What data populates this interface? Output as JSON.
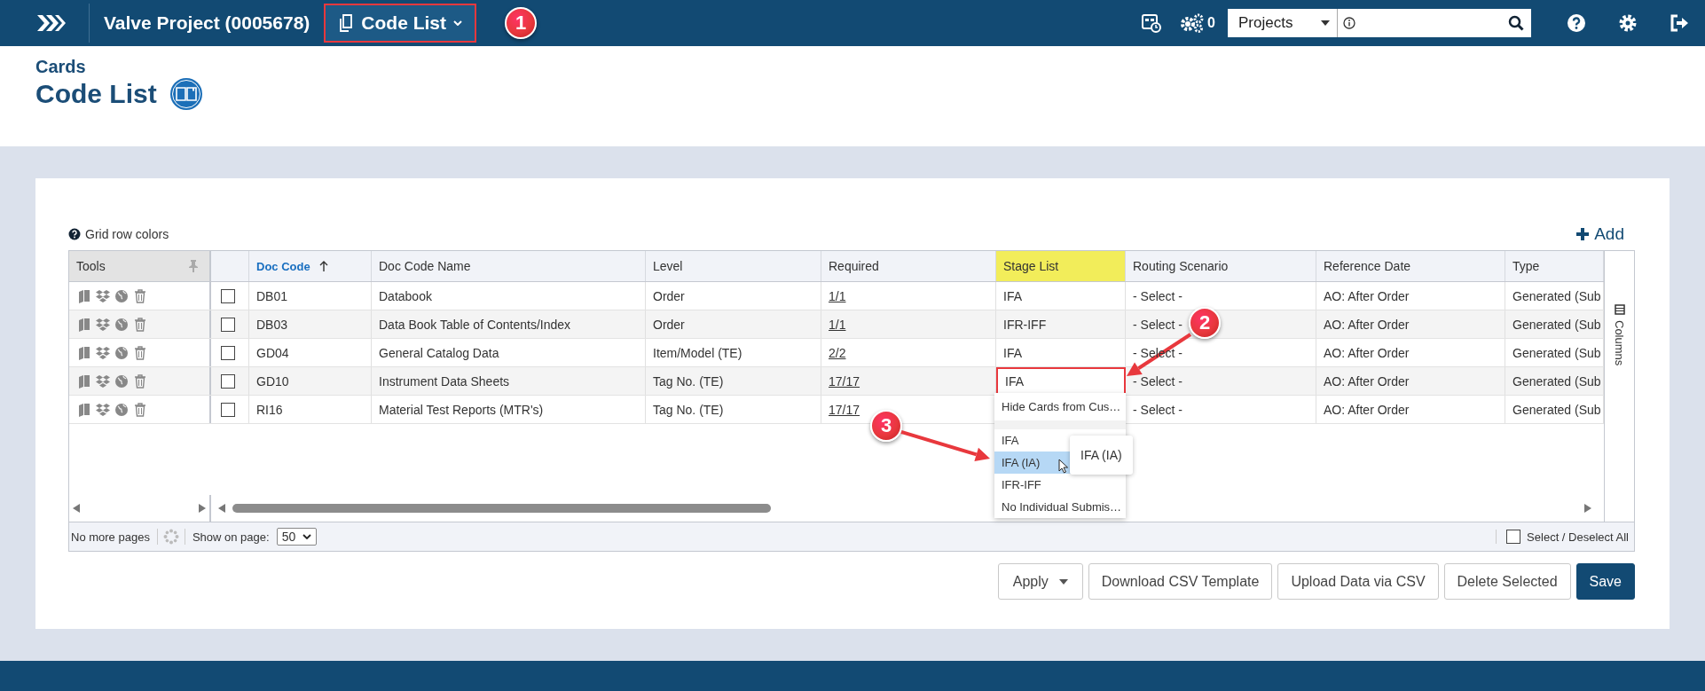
{
  "top_bar": {
    "breadcrumbs": [
      {
        "label": "Valve Project (0005678)",
        "current": false,
        "boxed": false
      },
      {
        "label": "Code List",
        "current": true,
        "boxed": true
      }
    ],
    "jobs_count": "0",
    "search_scope": "Projects"
  },
  "callouts": [
    {
      "number": "1"
    },
    {
      "number": "2"
    },
    {
      "number": "3"
    }
  ],
  "page": {
    "section": "Cards",
    "title": "Code List"
  },
  "grid": {
    "help_link": "Grid row colors",
    "add": "Add",
    "columns": [
      {
        "label": "Tools",
        "sorted": false,
        "highlighted": false
      },
      {
        "label": "Doc Code",
        "sorted": true,
        "highlighted": false
      },
      {
        "label": "Doc Code Name",
        "sorted": false,
        "highlighted": false
      },
      {
        "label": "Level",
        "sorted": false,
        "highlighted": false
      },
      {
        "label": "Required",
        "sorted": false,
        "highlighted": false
      },
      {
        "label": "Stage List",
        "sorted": false,
        "highlighted": true
      },
      {
        "label": "Routing Scenario",
        "sorted": false,
        "highlighted": false
      },
      {
        "label": "Reference Date",
        "sorted": false,
        "highlighted": false
      },
      {
        "label": "Type",
        "sorted": false,
        "highlighted": false
      }
    ],
    "rows": [
      {
        "checked": false,
        "boxed": false,
        "code": "DB01",
        "name": "Databook",
        "level": "Order",
        "required": "1/1",
        "stage": "IFA",
        "routing": "- Select -",
        "reference_date": "AO: After Order",
        "type": "Generated (Sub"
      },
      {
        "checked": false,
        "boxed": false,
        "code": "DB03",
        "name": "Data Book Table of Contents/Index",
        "level": "Order",
        "required": "1/1",
        "stage": "IFR-IFF",
        "routing": "- Select -",
        "reference_date": "AO: After Order",
        "type": "Generated (Sub"
      },
      {
        "checked": false,
        "boxed": false,
        "code": "GD04",
        "name": "General Catalog Data",
        "level": "Item/Model (TE)",
        "required": "2/2",
        "stage": "IFA",
        "routing": "- Select -",
        "reference_date": "AO: After Order",
        "type": "Generated (Sub"
      },
      {
        "checked": false,
        "boxed": true,
        "code": "GD10",
        "name": "Instrument Data Sheets",
        "level": "Tag No. (TE)",
        "required": "17/17",
        "stage": "IFA",
        "routing": "- Select -",
        "reference_date": "AO: After Order",
        "type": "Generated (Sub"
      },
      {
        "checked": false,
        "boxed": false,
        "code": "RI16",
        "name": "Material Test Reports (MTR's)",
        "level": "Tag No. (TE)",
        "required": "17/17",
        "routing": "- Select -",
        "reference_date": "AO: After Order",
        "type": "Generated (Sub"
      }
    ],
    "dropdown": {
      "options": [
        {
          "label": "Hide Cards from Cus…",
          "selected": false
        },
        {
          "label": "IFA",
          "selected": false
        },
        {
          "label": "IFA (IA)",
          "selected": true
        },
        {
          "label": "IFR-IFF",
          "selected": false
        },
        {
          "label": "No Individual Submis…",
          "selected": false
        }
      ],
      "tooltip": "IFA (IA)"
    },
    "side_panel": "Columns",
    "paging": {
      "status": "No more pages",
      "page_size_label": "Show on page:",
      "page_size": "50"
    },
    "select_all": {
      "label": "Select / Deselect All",
      "checked": false
    }
  },
  "actions": [
    {
      "label": "Apply",
      "kind": "menu"
    },
    {
      "label": "Download CSV Template",
      "kind": "default"
    },
    {
      "label": "Upload Data via CSV",
      "kind": "default"
    },
    {
      "label": "Delete Selected",
      "kind": "default"
    },
    {
      "label": "Save",
      "kind": "primary"
    }
  ]
}
